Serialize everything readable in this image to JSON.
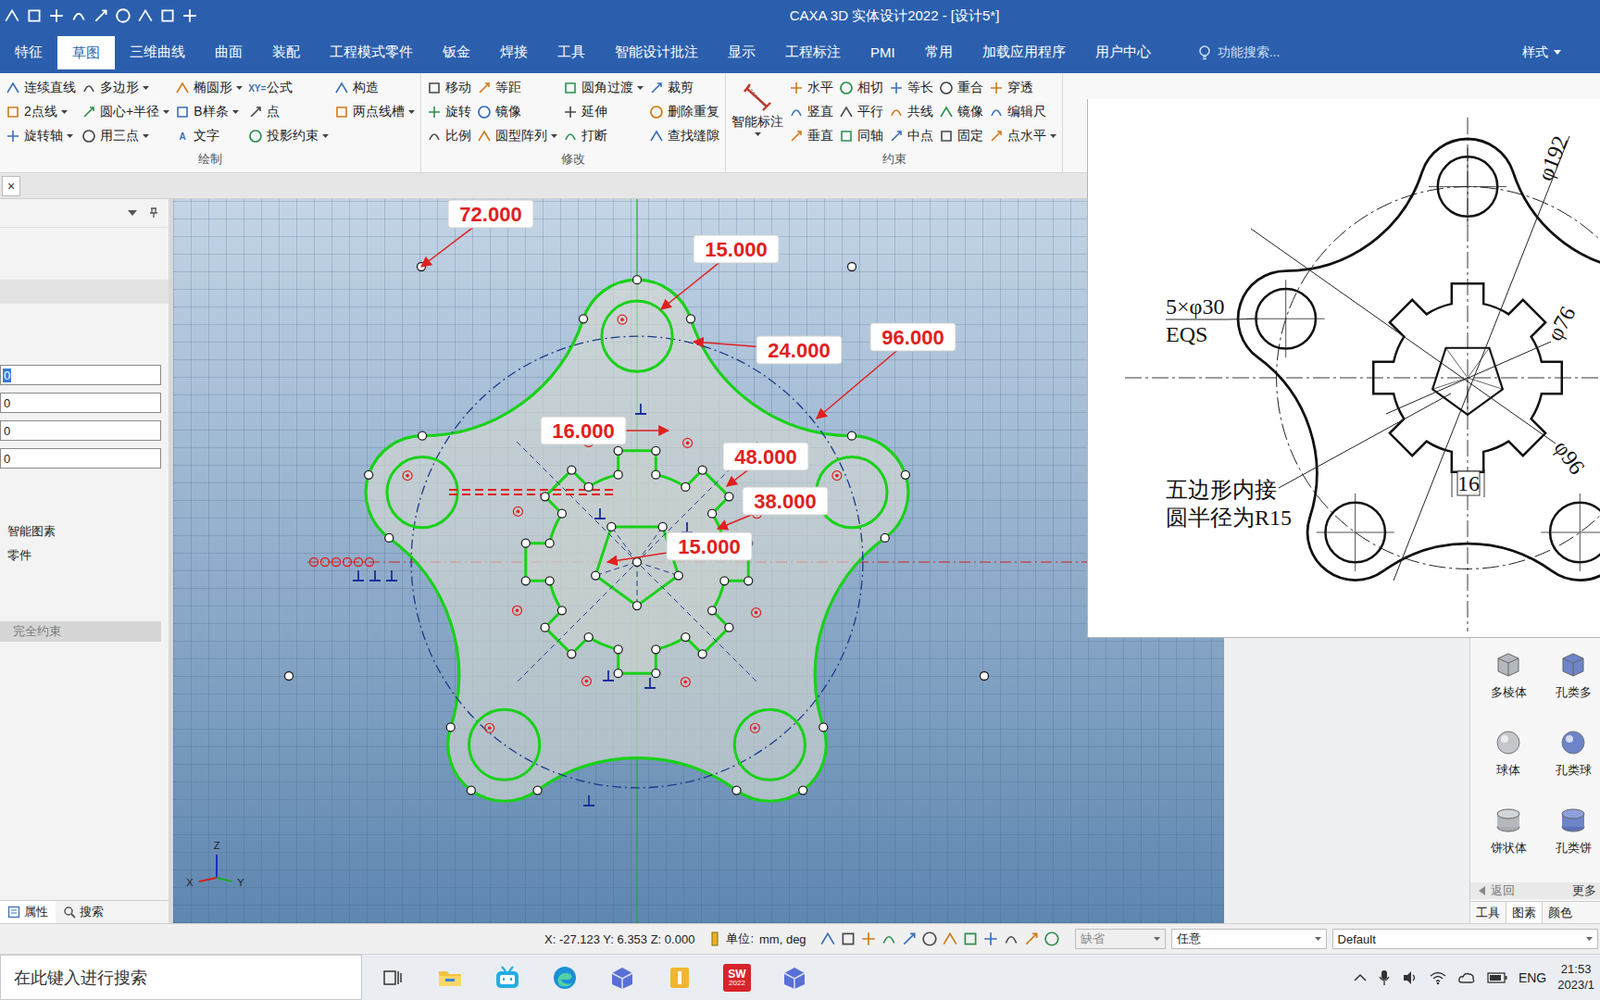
{
  "window": {
    "title": "CAXA 3D 实体设计2022 - [设计5*]"
  },
  "menu_tabs": [
    {
      "label": "特征",
      "selected": false
    },
    {
      "label": "草图",
      "selected": true
    },
    {
      "label": "三维曲线",
      "selected": false
    },
    {
      "label": "曲面",
      "selected": false
    },
    {
      "label": "装配",
      "selected": false
    },
    {
      "label": "工程模式零件",
      "selected": false
    },
    {
      "label": "钣金",
      "selected": false
    },
    {
      "label": "焊接",
      "selected": false
    },
    {
      "label": "工具",
      "selected": false
    },
    {
      "label": "智能设计批注",
      "selected": false
    },
    {
      "label": "显示",
      "selected": false
    },
    {
      "label": "工程标注",
      "selected": false
    },
    {
      "label": "PMI",
      "selected": false
    },
    {
      "label": "常用",
      "selected": false
    },
    {
      "label": "加载应用程序",
      "selected": false
    },
    {
      "label": "用户中心",
      "selected": false
    }
  ],
  "search": {
    "placeholder": "功能搜索..."
  },
  "style_menu": {
    "label": "样式"
  },
  "ribbon": {
    "groups": [
      {
        "label": "绘制",
        "columns": [
          [
            {
              "label": "连续直线",
              "dropdown": false
            },
            {
              "label": "2点线",
              "dropdown": true
            },
            {
              "label": "旋转轴",
              "dropdown": true
            }
          ],
          [
            {
              "label": "多边形",
              "dropdown": true
            },
            {
              "label": "圆心+半径",
              "dropdown": true
            },
            {
              "label": "用三点",
              "dropdown": true
            }
          ],
          [
            {
              "label": "椭圆形",
              "dropdown": true
            },
            {
              "label": "B样条",
              "dropdown": true
            },
            {
              "label": "文字",
              "dropdown": false,
              "glyph": "A"
            }
          ],
          [
            {
              "label": "公式",
              "dropdown": false,
              "glyph": "XY="
            },
            {
              "label": "点",
              "dropdown": false
            },
            {
              "label": "投影约束",
              "dropdown": true
            }
          ],
          [
            {
              "label": "构造",
              "dropdown": false
            },
            {
              "label": "两点线槽",
              "dropdown": true
            }
          ]
        ]
      },
      {
        "label": "修改",
        "columns": [
          [
            {
              "label": "移动",
              "dropdown": false
            },
            {
              "label": "旋转",
              "dropdown": false
            },
            {
              "label": "比例",
              "dropdown": false
            }
          ],
          [
            {
              "label": "等距",
              "dropdown": false
            },
            {
              "label": "镜像",
              "dropdown": false
            },
            {
              "label": "圆型阵列",
              "dropdown": true
            }
          ],
          [
            {
              "label": "圆角过渡",
              "dropdown": true
            },
            {
              "label": "延伸",
              "dropdown": false
            },
            {
              "label": "打断",
              "dropdown": false
            }
          ],
          [
            {
              "label": "裁剪",
              "dropdown": false
            },
            {
              "label": "删除重复",
              "dropdown": false
            },
            {
              "label": "查找缝隙",
              "dropdown": false
            }
          ]
        ]
      },
      {
        "label": "约束",
        "big": {
          "label": "智能标注",
          "dropdown": true
        },
        "columns": [
          [
            {
              "label": "水平",
              "dropdown": false
            },
            {
              "label": "竖直",
              "dropdown": false
            },
            {
              "label": "垂直",
              "dropdown": false
            }
          ],
          [
            {
              "label": "相切",
              "dropdown": false
            },
            {
              "label": "平行",
              "dropdown": false
            },
            {
              "label": "同轴",
              "dropdown": false
            }
          ],
          [
            {
              "label": "等长",
              "dropdown": false
            },
            {
              "label": "共线",
              "dropdown": false
            },
            {
              "label": "中点",
              "dropdown": false
            }
          ],
          [
            {
              "label": "重合",
              "dropdown": false
            },
            {
              "label": "镜像",
              "dropdown": false
            },
            {
              "label": "固定",
              "dropdown": false
            }
          ],
          [
            {
              "label": "穿透",
              "dropdown": false
            },
            {
              "label": "编辑尺",
              "dropdown": false
            },
            {
              "label": "点水平",
              "dropdown": true
            }
          ]
        ]
      }
    ]
  },
  "doc_strip": {
    "close": "×"
  },
  "left_panel": {
    "fields": [
      {
        "value": "0",
        "selected": true
      },
      {
        "value": "0",
        "selected": false
      },
      {
        "value": "0",
        "selected": false
      },
      {
        "value": "0",
        "selected": false
      }
    ],
    "items": [
      "智能图素",
      "零件"
    ],
    "status": {
      "label": "完全约束",
      "disabled": true
    },
    "tabs": [
      {
        "label": "属性",
        "selected": true
      },
      {
        "label": "搜索",
        "selected": false
      }
    ]
  },
  "sketch": {
    "dimensions": [
      {
        "text": "72.000"
      },
      {
        "text": "15.000"
      },
      {
        "text": "24.000"
      },
      {
        "text": "96.000"
      },
      {
        "text": "16.000"
      },
      {
        "text": "48.000"
      },
      {
        "text": "38.000"
      },
      {
        "text": "15.000"
      }
    ],
    "axes": [
      "Z",
      "X",
      "Y"
    ]
  },
  "reference_image": {
    "dia_outer": "φ192",
    "holes": "5×φ30",
    "eqs": "EQS",
    "dia_root": "φ76",
    "dia_tip": "φ96",
    "key_width": "16",
    "note_line1": "五边形内接",
    "note_line2": "圆半径为R15"
  },
  "library": {
    "items": [
      {
        "label": "多棱体",
        "kind": "prism",
        "hole": false
      },
      {
        "label": "孔类多",
        "kind": "prism",
        "hole": true
      },
      {
        "label": "球体",
        "kind": "sphere",
        "hole": false
      },
      {
        "label": "孔类球",
        "kind": "sphere",
        "hole": true
      },
      {
        "label": "饼状体",
        "kind": "cylinder",
        "hole": false
      },
      {
        "label": "孔类饼",
        "kind": "cylinder",
        "hole": true
      }
    ],
    "back": "返回",
    "more": "更多",
    "tabs": [
      {
        "label": "工具",
        "selected": false
      },
      {
        "label": "图素",
        "selected": true
      },
      {
        "label": "颜色",
        "selected": false
      }
    ]
  },
  "status_bar": {
    "coords": "X: -27.123 Y: 6.353 Z: 0.000",
    "unit_label": "单位:",
    "unit_value": "mm, deg",
    "selects": [
      {
        "value": "缺省",
        "disabled": true
      },
      {
        "value": "任意",
        "disabled": false
      },
      {
        "value": "Default",
        "disabled": false
      }
    ]
  },
  "taskbar": {
    "search_placeholder": "在此键入进行搜索",
    "apps": [
      {
        "kind": "taskview"
      },
      {
        "kind": "explorer"
      },
      {
        "kind": "bilibili"
      },
      {
        "kind": "edge"
      },
      {
        "kind": "caxa"
      },
      {
        "kind": "inventor"
      },
      {
        "kind": "solidworks",
        "label": "SW",
        "sub": "2022"
      },
      {
        "kind": "caxa"
      }
    ],
    "tray": {
      "language": "ENG",
      "time": "21:53",
      "date": "2023/1"
    }
  }
}
